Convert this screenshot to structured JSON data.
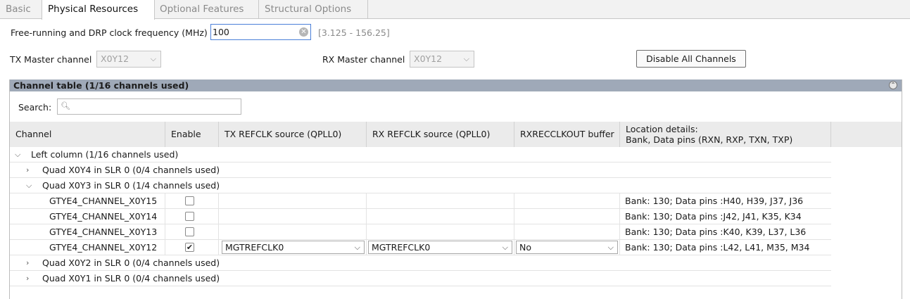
{
  "tabs": [
    "Basic",
    "Physical Resources",
    "Optional Features",
    "Structural Options"
  ],
  "freq": {
    "label": "Free-running and DRP clock frequency (MHz)",
    "value": "100",
    "range": "[3.125 - 156.25]"
  },
  "tx_master": {
    "label": "TX Master channel",
    "value": "X0Y12"
  },
  "rx_master": {
    "label": "RX Master channel",
    "value": "X0Y12"
  },
  "disable_button": "Disable All Channels",
  "panel_title": "Channel table (1/16 channels used)",
  "search_label": "Search:",
  "search_placeholder": "",
  "columns": {
    "channel": "Channel",
    "enable": "Enable",
    "tx": "TX REFCLK source (QPLL0)",
    "rx": "RX REFCLK source (QPLL0)",
    "rxrecclk": "RXRECCLKOUT buffer",
    "loc1": "Location details:",
    "loc2": "Bank, Data pins (RXN, RXP, TXN, TXP)"
  },
  "tree": {
    "left_column": "Left column (1/16 channels used)",
    "quad_x0y4": "Quad X0Y4 in SLR 0 (0/4 channels used)",
    "quad_x0y3": "Quad X0Y3 in SLR 0 (1/4 channels used)",
    "quad_x0y2": "Quad X0Y2 in SLR 0 (0/4 channels used)",
    "quad_x0y1": "Quad X0Y1 in SLR 0 (0/4 channels used)"
  },
  "channels": [
    {
      "name": "GTYE4_CHANNEL_X0Y15",
      "enabled": false,
      "location": "Bank: 130; Data pins :H40, H39, J37, J36"
    },
    {
      "name": "GTYE4_CHANNEL_X0Y14",
      "enabled": false,
      "location": "Bank: 130; Data pins :J42, J41, K35, K34"
    },
    {
      "name": "GTYE4_CHANNEL_X0Y13",
      "enabled": false,
      "location": "Bank: 130; Data pins :K40, K39, L37, L36"
    },
    {
      "name": "GTYE4_CHANNEL_X0Y12",
      "enabled": true,
      "tx": "MGTREFCLK0",
      "rx": "MGTREFCLK0",
      "rxrecclk": "No",
      "location": "Bank: 130; Data pins :L42, L41, M35, M34"
    }
  ],
  "colors": {
    "accent": "#4a7fd8",
    "panel_header": "#9fa9b8"
  }
}
